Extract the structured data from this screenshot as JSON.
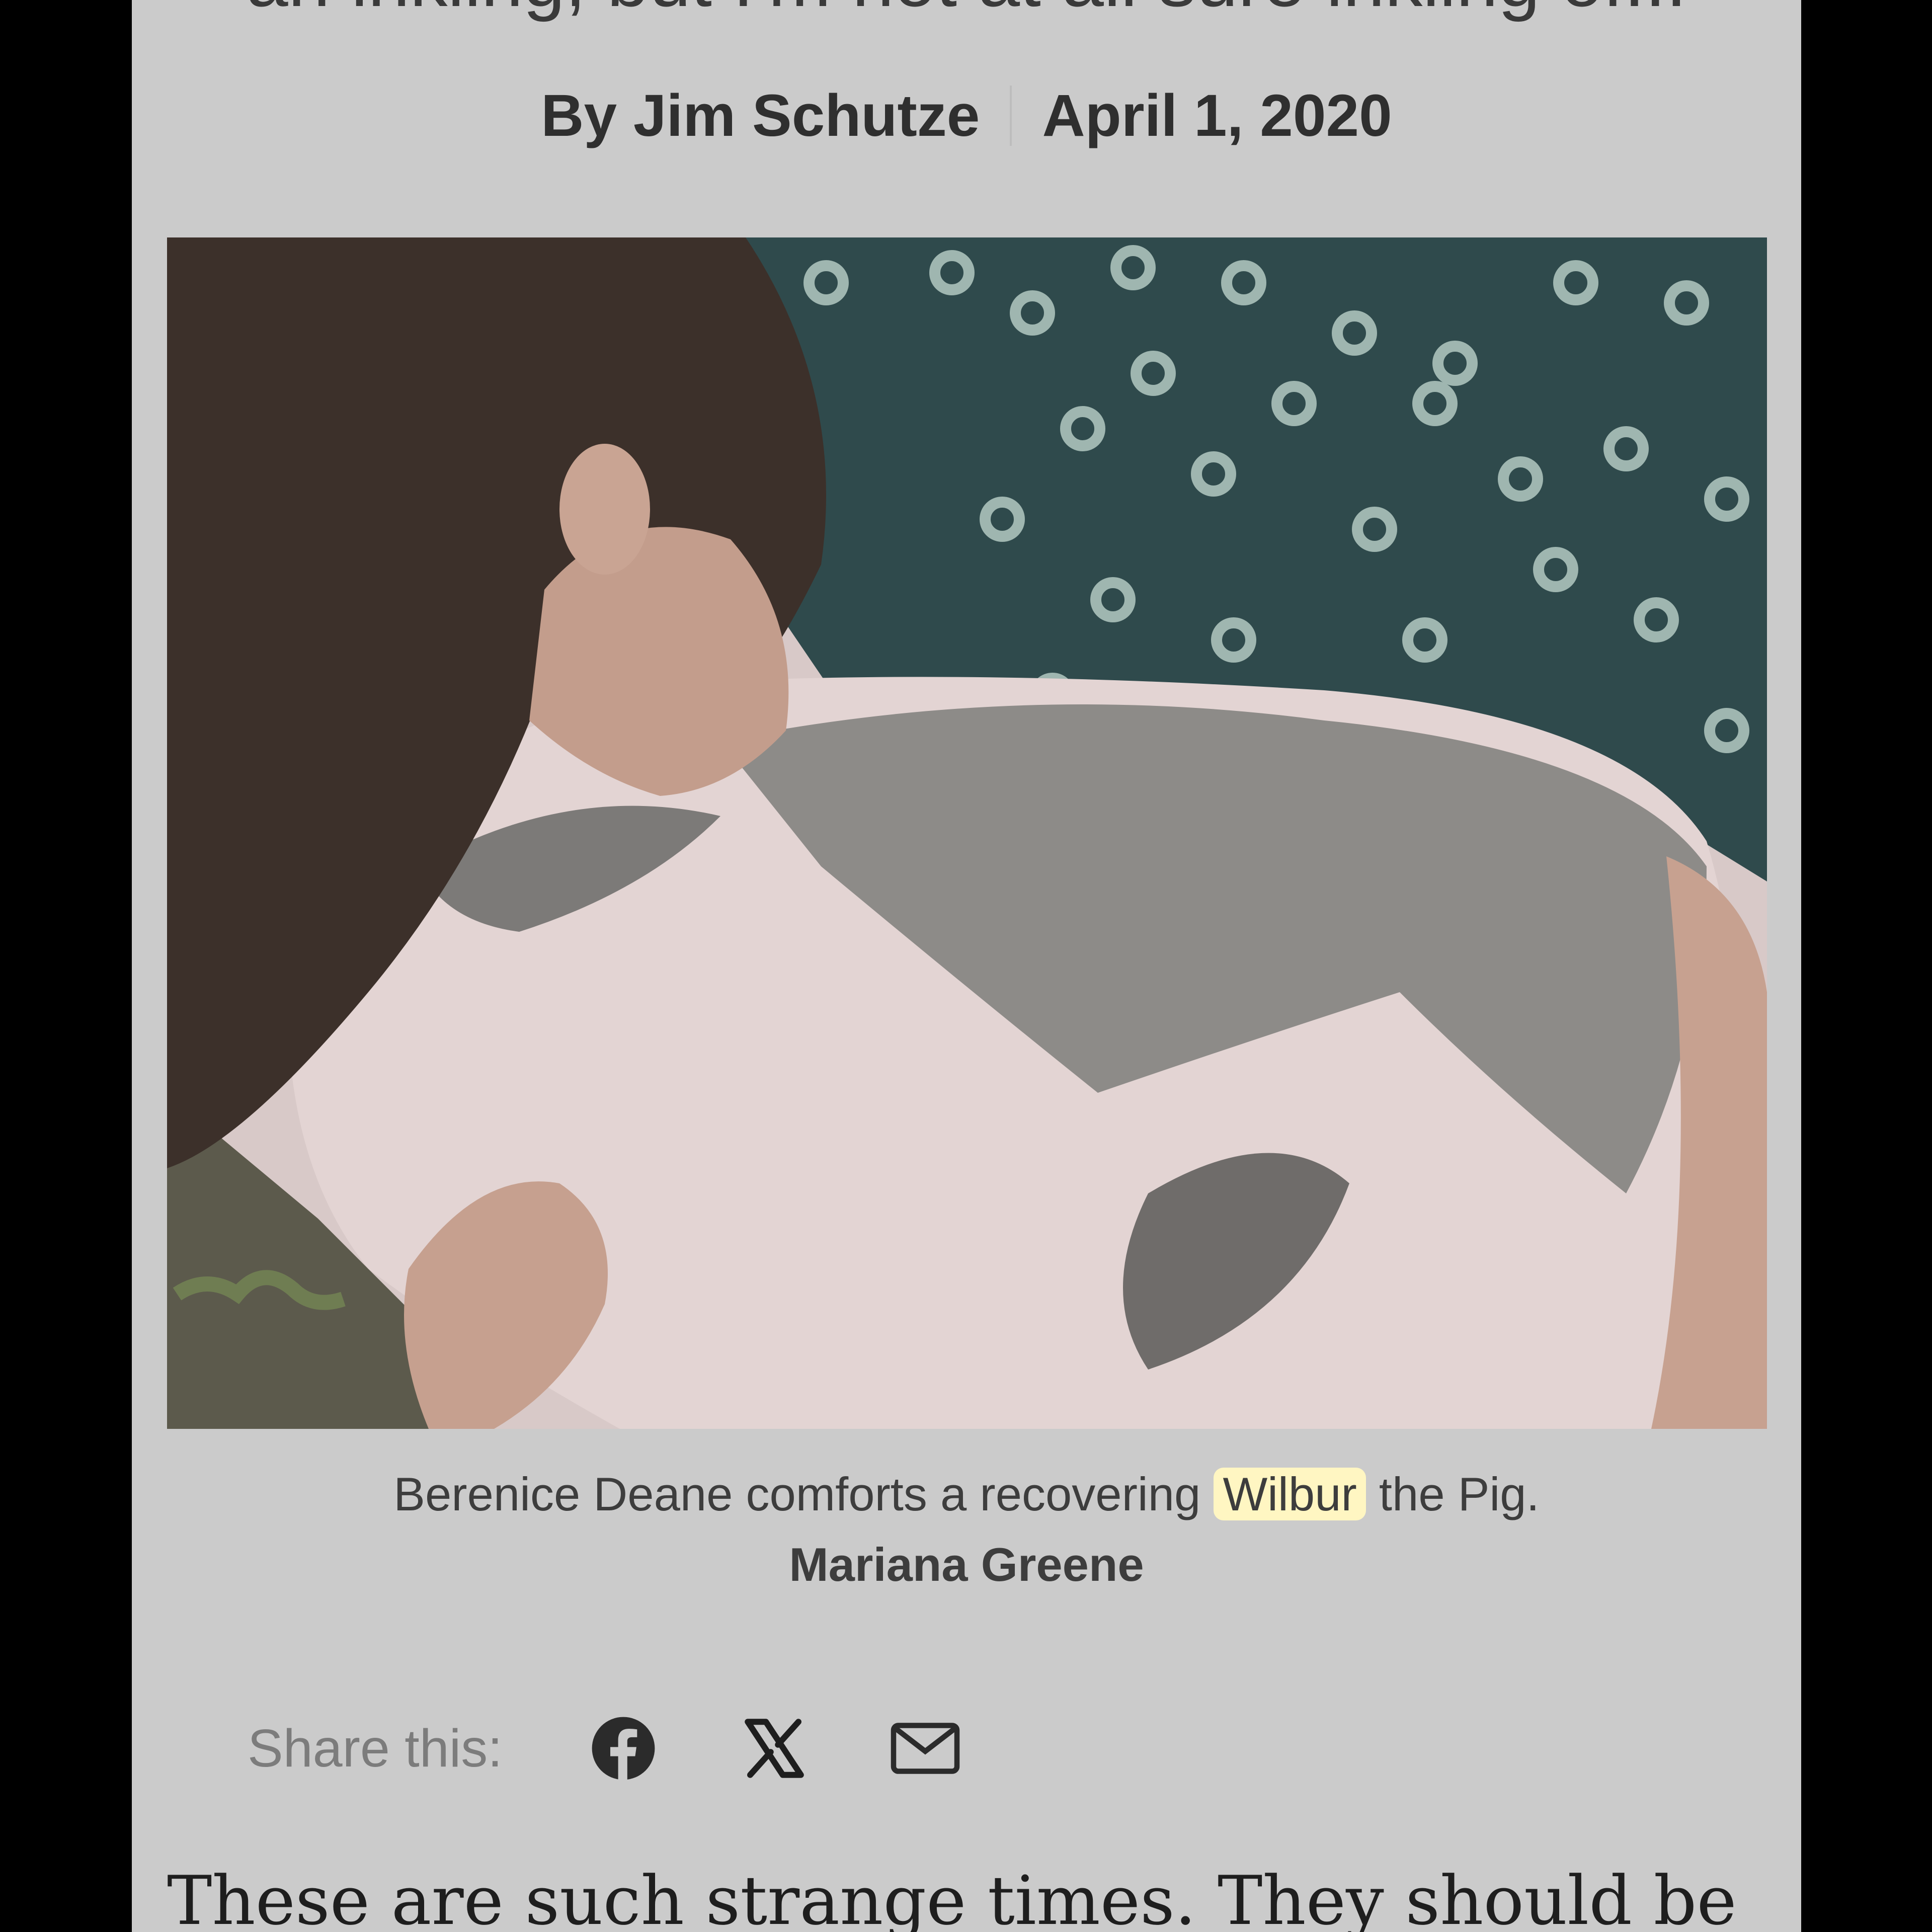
{
  "article": {
    "title_partial": "an inkling, but I'm not at all sure inkling of...",
    "byline": "By Jim Schutze",
    "date": "April 1, 2020",
    "caption_before": "Berenice Deane comforts a recovering",
    "caption_highlight": "Wilbur",
    "caption_after": "the Pig.",
    "photo_credit": "Mariana Greene",
    "body_first_line": "These are such strange times. They should be"
  },
  "share": {
    "label": "Share this:",
    "icons": [
      "facebook-icon",
      "x-icon",
      "mail-icon"
    ]
  },
  "colors": {
    "page_bg": "#cbcbcb",
    "highlight": "#fff6c2",
    "frame": "#000000"
  }
}
